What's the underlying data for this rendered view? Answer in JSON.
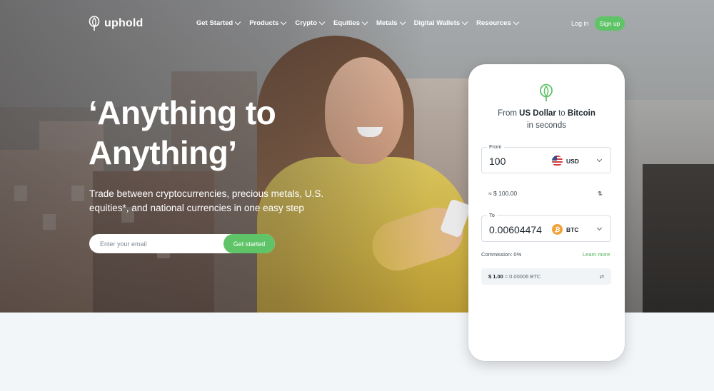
{
  "brand": {
    "name": "uphold",
    "accent": "#5fc467"
  },
  "nav": {
    "items": [
      {
        "label": "Get Started"
      },
      {
        "label": "Products"
      },
      {
        "label": "Crypto"
      },
      {
        "label": "Equities"
      },
      {
        "label": "Metals"
      },
      {
        "label": "Digital Wallets"
      },
      {
        "label": "Resources"
      }
    ],
    "login": "Log in",
    "signup": "Sign up"
  },
  "hero": {
    "headline_line1": "‘Anything to",
    "headline_line2": "Anything’",
    "subline": "Trade between cryptocurrencies, precious metals, U.S. equities*, and national currencies in one easy step",
    "email_placeholder": "Enter your email",
    "cta": "Get started"
  },
  "widget": {
    "title_prefix": "From ",
    "title_from": "US Dollar",
    "title_mid": " to ",
    "title_to": "Bitcoin",
    "title_suffix": "in seconds",
    "from": {
      "label": "From",
      "amount": "100",
      "currency": "USD",
      "icon": "us-flag-icon"
    },
    "approx": "≈ $ 100.00",
    "to": {
      "label": "To",
      "amount": "0.00604474",
      "currency": "BTC",
      "icon": "bitcoin-icon",
      "symbol": "₿"
    },
    "commission": "Commission: 0%",
    "learn_more": "Learn more",
    "rate_left": "$ 1.00",
    "rate_right": " ≈ 0.00006 BTC"
  }
}
